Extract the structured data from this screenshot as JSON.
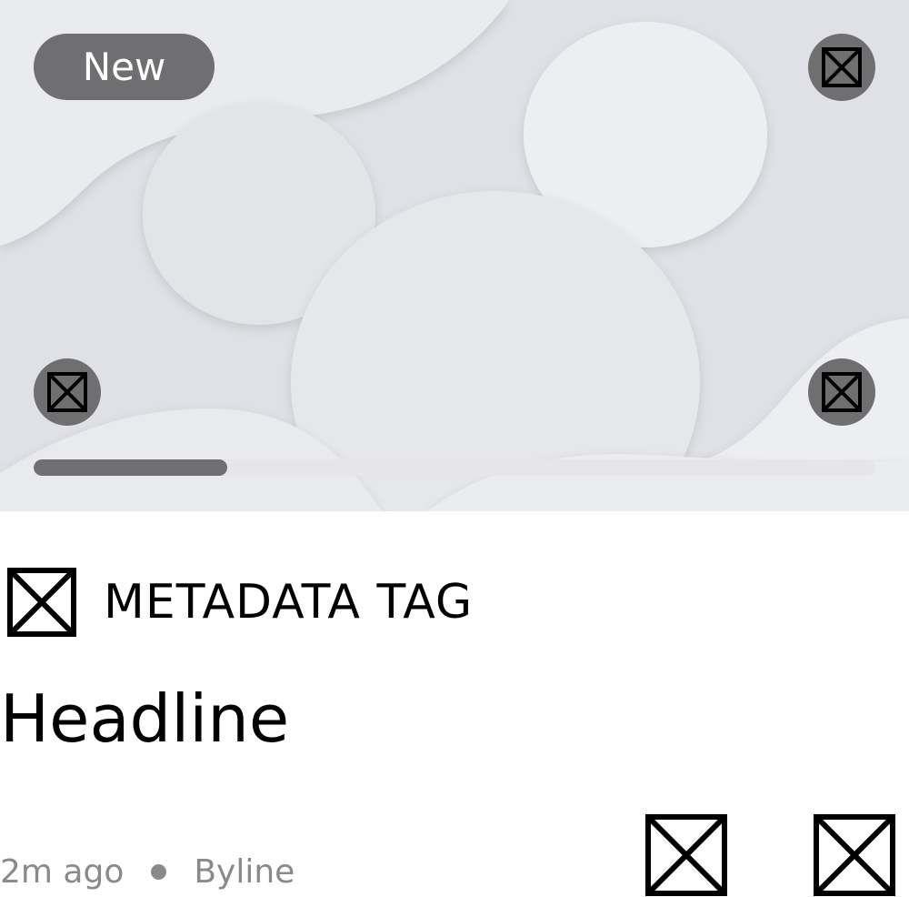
{
  "media": {
    "badge": "New",
    "icons": {
      "top_right": "placeholder-icon",
      "bottom_left": "placeholder-icon",
      "bottom_right": "placeholder-icon"
    },
    "progress": 0.23,
    "colors": {
      "overlay": "#6f6f71",
      "track": "#e6e6e8",
      "background": "#dfe1e6"
    }
  },
  "meta": {
    "icon": "placeholder-icon",
    "tag": "METADATA TAG"
  },
  "headline": "Headline",
  "footer": {
    "time": "2m ago",
    "byline": "Byline",
    "actions": [
      "placeholder-icon",
      "placeholder-icon"
    ]
  }
}
